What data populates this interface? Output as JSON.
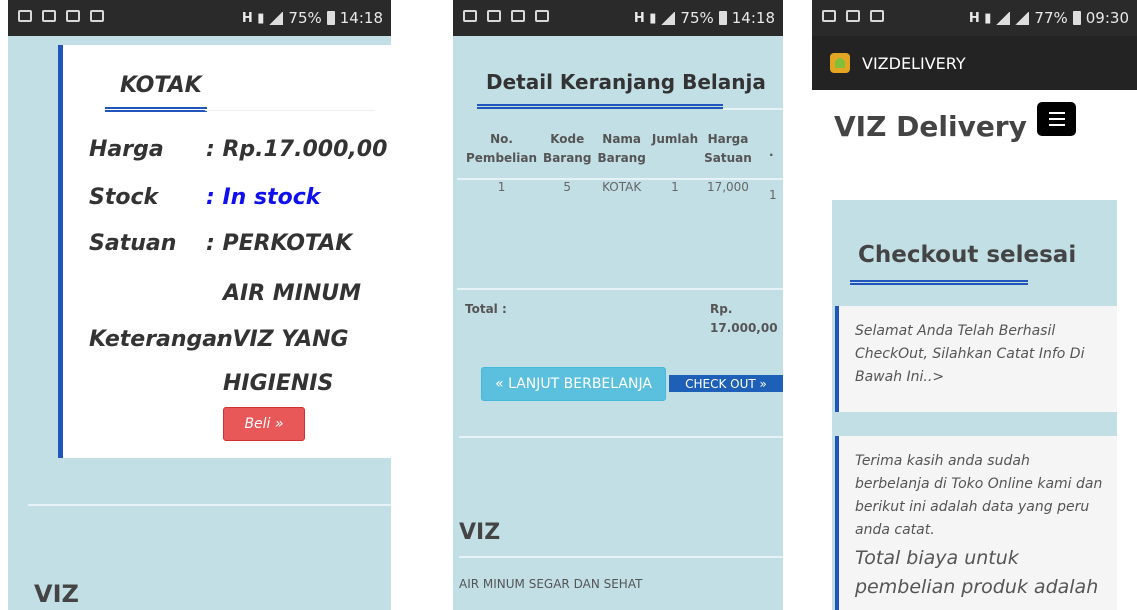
{
  "phone1": {
    "status": {
      "battery": "75%",
      "time": "14:18"
    },
    "product": {
      "title": "KOTAK",
      "rows": [
        {
          "label": "Harga",
          "value": ": Rp.17.000,00"
        },
        {
          "label": "Stock",
          "value": ": In stock"
        },
        {
          "label": "Satuan",
          "value": ": PERKOTAK"
        },
        {
          "label": "",
          "value": "AIR MINUM"
        },
        {
          "label": "Keterangan",
          "value": ": VIZ YANG"
        },
        {
          "label": "",
          "value": "HIGIENIS"
        }
      ],
      "buy_label": "Beli »"
    },
    "footer_brand": "VIZ"
  },
  "phone2": {
    "status": {
      "battery": "75%",
      "time": "14:18"
    },
    "title": "Detail Keranjang Belanja",
    "table": {
      "headers": [
        [
          "No.",
          "Pembelian"
        ],
        [
          "Kode",
          "Barang"
        ],
        [
          "Nama",
          "Barang"
        ],
        [
          "Jumlah",
          ""
        ],
        [
          "Harga",
          "Satuan"
        ]
      ],
      "rows": [
        [
          "1",
          "5",
          "KOTAK",
          "1",
          "17,000"
        ]
      ],
      "overflow_cell": "1"
    },
    "total_label": "Total :",
    "total_value_line1": "Rp.",
    "total_value_line2": "17.000,00",
    "continue_label": "« LANJUT BERBELANJA",
    "checkout_label": "CHECK OUT »",
    "footer_brand": "VIZ",
    "footer_text": "AIR MINUM SEGAR DAN SEHAT"
  },
  "phone3": {
    "status": {
      "battery": "77%",
      "time": "09:30"
    },
    "app_title": "VIZDELIVERY",
    "brand": "VIZ Delivery",
    "section_title": "Checkout selesai",
    "message1": "Selamat Anda Telah Berhasil CheckOut, Silahkan Catat Info Di Bawah Ini..>",
    "message2": "Terima kasih anda sudah berbelanja di Toko Online kami dan berikut ini adalah data yang peru anda catat.",
    "message3": "Total biaya untuk pembelian produk adalah"
  },
  "colors": {
    "page_bg": "#c2dfe6",
    "accent_blue": "#2255bb",
    "buy_red": "#e85858",
    "continue_cyan": "#5bc0de",
    "checkout_blue": "#1e5fb8",
    "in_stock_blue": "#1010ee"
  }
}
